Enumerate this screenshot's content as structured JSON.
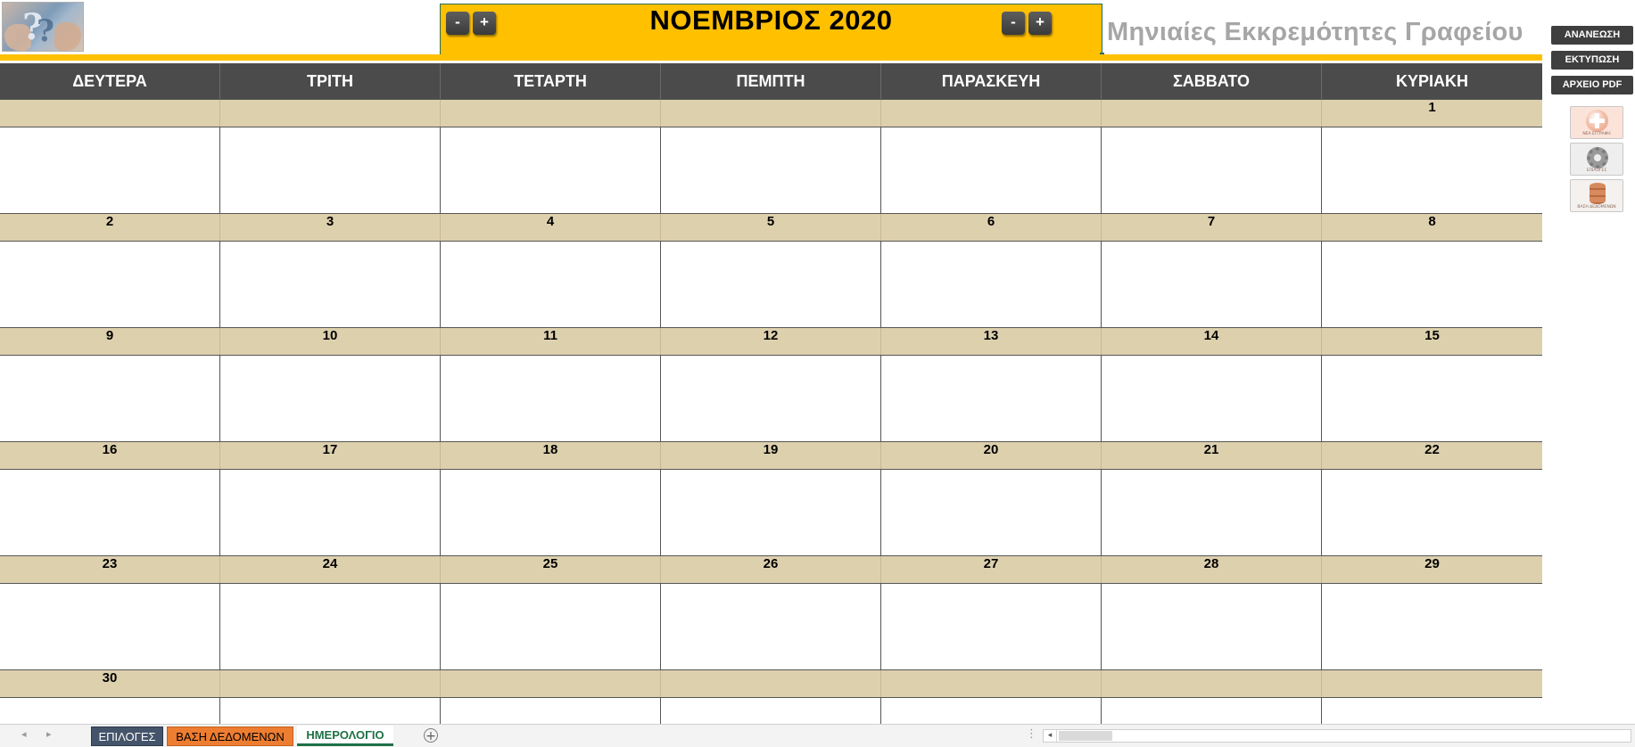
{
  "header": {
    "month_title": "ΝΟΕΜΒΡΙΟΣ 2020",
    "subtitle": "Μηνιαίες Εκκρεμότητες Γραφείου",
    "year_minus": "-",
    "year_plus": "+",
    "month_minus": "-",
    "month_plus": "+"
  },
  "side_buttons": {
    "refresh": "ΑΝΑΝΕΩΣΗ",
    "print": "ΕΚΤΥΠΩΣΗ",
    "pdf": "ΑΡΧΕΙΟ PDF"
  },
  "icon_buttons": {
    "new_entry": "ΝΕΑ ΕΓΓΡΑΦΗ",
    "options": "ΕΠΙΛΟΓΕΣ",
    "database": "ΒΑΣΗ ΔΕΔΟΜΕΝΩΝ"
  },
  "calendar": {
    "days": [
      "ΔΕΥΤΕΡΑ",
      "ΤΡΙΤΗ",
      "ΤΕΤΑΡΤΗ",
      "ΠΕΜΠΤΗ",
      "ΠΑΡΑΣΚΕΥΗ",
      "ΣΑΒΒΑΤΟ",
      "ΚΥΡΙΑΚΗ"
    ],
    "weeks": [
      [
        "",
        "",
        "",
        "",
        "",
        "",
        "1"
      ],
      [
        "2",
        "3",
        "4",
        "5",
        "6",
        "7",
        "8"
      ],
      [
        "9",
        "10",
        "11",
        "12",
        "13",
        "14",
        "15"
      ],
      [
        "16",
        "17",
        "18",
        "19",
        "20",
        "21",
        "22"
      ],
      [
        "23",
        "24",
        "25",
        "26",
        "27",
        "28",
        "29"
      ],
      [
        "30",
        "",
        "",
        "",
        "",
        "",
        ""
      ]
    ]
  },
  "sheet_tabs": {
    "options": "ΕΠΙΛΟΓΕΣ",
    "database": "ΒΑΣΗ ΔΕΔΟΜΕΝΩΝ",
    "calendar": "ΗΜΕΡΟΛΟΓΙΟ",
    "active": "ΗΜΕΡΟΛΟΓΙΟ"
  },
  "colors": {
    "banner": "#ffc000",
    "header_bar": "#4b4b4b",
    "date_row": "#ddd0ad",
    "tab_options": "#44546a",
    "tab_database": "#ed7d31",
    "tab_active_text": "#1e7145"
  }
}
